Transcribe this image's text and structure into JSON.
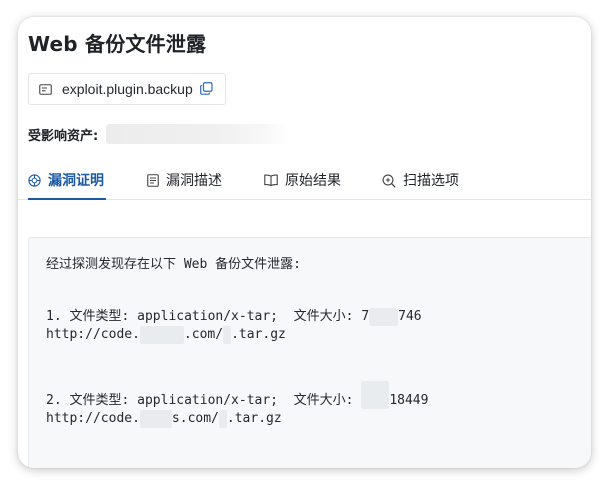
{
  "title": "Web 备份文件泄露",
  "plugin": {
    "id_icon": "id-card-icon",
    "name": "exploit.plugin.backup",
    "copy_icon": "copy-icon"
  },
  "affected": {
    "label": "受影响资产:"
  },
  "tabs": [
    {
      "label": "漏洞证明",
      "icon": "bug-target-icon",
      "active": true
    },
    {
      "label": "漏洞描述",
      "icon": "document-icon",
      "active": false
    },
    {
      "label": "原始结果",
      "icon": "book-icon",
      "active": false
    },
    {
      "label": "扫描选项",
      "icon": "search-plus-icon",
      "active": false
    }
  ],
  "result": {
    "intro": "经过探测发现存在以下 Web 备份文件泄露:",
    "files": [
      {
        "type_prefix": "1. 文件类型: application/x-tar;  文件大小: 7",
        "size_tail": "746",
        "url_prefix": "http://code.",
        "url_mid": ".com/",
        "url_tail": ".tar.gz"
      },
      {
        "type_prefix": "2. 文件类型: application/x-tar;  文件大小: ",
        "size_tail": "18449",
        "url_prefix": "http://code.",
        "url_mid": "s.com/",
        "url_tail": ".tar.gz"
      }
    ]
  },
  "colors": {
    "accent": "#1d5aa6",
    "panel_bg": "#f6f8fa",
    "text": "#1f2328"
  }
}
